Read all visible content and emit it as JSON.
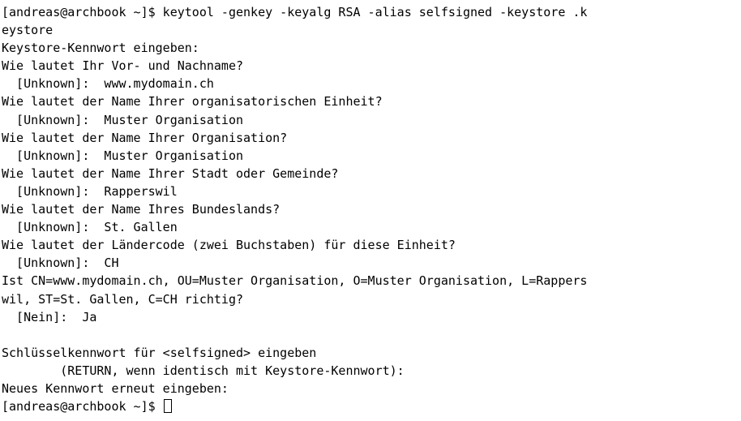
{
  "terminal": {
    "lines": [
      "[andreas@archbook ~]$ keytool -genkey -keyalg RSA -alias selfsigned -keystore .k",
      "eystore",
      "Keystore-Kennwort eingeben:",
      "Wie lautet Ihr Vor- und Nachname?",
      "  [Unknown]:  www.mydomain.ch",
      "Wie lautet der Name Ihrer organisatorischen Einheit?",
      "  [Unknown]:  Muster Organisation",
      "Wie lautet der Name Ihrer Organisation?",
      "  [Unknown]:  Muster Organisation",
      "Wie lautet der Name Ihrer Stadt oder Gemeinde?",
      "  [Unknown]:  Rapperswil",
      "Wie lautet der Name Ihres Bundeslands?",
      "  [Unknown]:  St. Gallen",
      "Wie lautet der Ländercode (zwei Buchstaben) für diese Einheit?",
      "  [Unknown]:  CH",
      "Ist CN=www.mydomain.ch, OU=Muster Organisation, O=Muster Organisation, L=Rappers",
      "wil, ST=St. Gallen, C=CH richtig?",
      "  [Nein]:  Ja",
      "",
      "Schlüsselkennwort für <selfsigned> eingeben",
      "        (RETURN, wenn identisch mit Keystore-Kennwort):",
      "Neues Kennwort erneut eingeben:"
    ],
    "prompt": "[andreas@archbook ~]$ "
  }
}
